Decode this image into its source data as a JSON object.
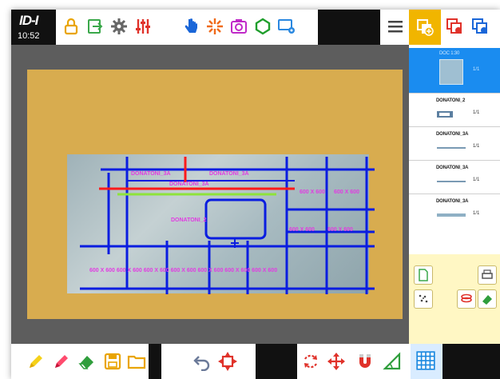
{
  "app": {
    "clock": "10:52",
    "logo_text": "ID-I"
  },
  "toolbar_top": {
    "icons": [
      "lock-icon",
      "export-icon",
      "gear-icon",
      "sliders-icon",
      "hand-icon",
      "spark-icon",
      "camera-icon",
      "polygon-icon",
      "screen-settings-icon",
      "menu-icon",
      "layer-add-icon",
      "layer-remove-icon",
      "layer-info-icon"
    ]
  },
  "canvas": {
    "labels": {
      "top_left": "DONATONI_3A",
      "top_right": "DONATONI_3A",
      "top_center": "DONATONI_3A",
      "inner": "DONATONI_2",
      "right_1": "600 X 600",
      "right_2": "600 X 600",
      "right_3": "600 X 600",
      "right_4": "600 X 600",
      "bottom_row": "600 X 600   600 X 600   600 X 600   600 X 600   600 X 600   600 X 600   600 X 600"
    },
    "colors": {
      "sheet": "#d8ac4f",
      "grid_lines": "#0a1de0",
      "red_line": "#ff1a1a",
      "green_line": "#8ee33a",
      "label": "#e23be2"
    }
  },
  "layers_panel": {
    "items": [
      {
        "name": "DOC 1:30",
        "count": "1/1",
        "selected": true
      },
      {
        "name": "DONATONI_2",
        "count": "1/1",
        "selected": false
      },
      {
        "name": "DONATONI_3A",
        "count": "1/1",
        "selected": false
      },
      {
        "name": "DONATONI_3A",
        "count": "1/1",
        "selected": false
      },
      {
        "name": "DONATONI_3A",
        "count": "1/1",
        "selected": false
      }
    ]
  },
  "toolbar_bottom": {
    "icons": [
      "pencil-yellow-icon",
      "pencil-red-icon",
      "eraser-icon",
      "save-icon",
      "folder-icon",
      "undo-icon",
      "move-target-icon",
      "rotate-icon",
      "move-arrows-icon",
      "magnet-icon",
      "angle-ruler-icon",
      "grid-icon"
    ]
  }
}
